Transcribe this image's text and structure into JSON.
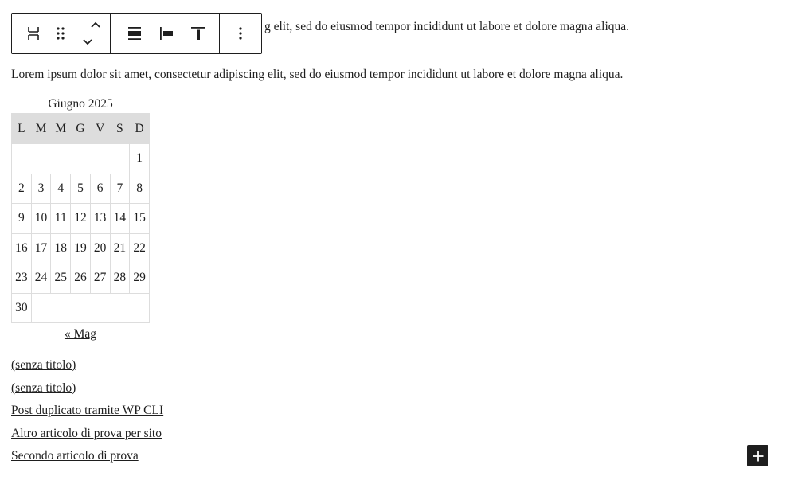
{
  "paragraphs": {
    "first_visible": "g elit, sed do eiusmod tempor incididunt ut labore et dolore magna aliqua.",
    "second": "Lorem ipsum dolor sit amet, consectetur adipiscing elit, sed do eiusmod tempor incididunt ut labore et dolore magna aliqua."
  },
  "toolbar": {
    "buttons": [
      {
        "name": "block-type-icon"
      },
      {
        "name": "drag-handle-icon"
      },
      {
        "name": "move-up-down-icon"
      },
      {
        "name": "align-icon"
      },
      {
        "name": "justify-left-icon"
      },
      {
        "name": "vertical-align-top-icon"
      },
      {
        "name": "more-options-icon"
      }
    ]
  },
  "calendar": {
    "caption": "Giugno 2025",
    "weekdays": [
      "L",
      "M",
      "M",
      "G",
      "V",
      "S",
      "D"
    ],
    "weeks": [
      [
        "",
        "",
        "",
        "",
        "",
        "",
        "1"
      ],
      [
        "2",
        "3",
        "4",
        "5",
        "6",
        "7",
        "8"
      ],
      [
        "9",
        "10",
        "11",
        "12",
        "13",
        "14",
        "15"
      ],
      [
        "16",
        "17",
        "18",
        "19",
        "20",
        "21",
        "22"
      ],
      [
        "23",
        "24",
        "25",
        "26",
        "27",
        "28",
        "29"
      ],
      [
        "30"
      ]
    ],
    "prev_link": "« Mag"
  },
  "posts": [
    "(senza titolo)",
    "(senza titolo)",
    "Post duplicato tramite WP CLI",
    "Altro articolo di prova per sito",
    "Secondo articolo di prova"
  ],
  "inserter": {
    "icon": "plus-icon"
  },
  "colors": {
    "text": "#1e1e1e",
    "table_header": "#dddddd",
    "inserter_bg": "#1e1e1e"
  }
}
